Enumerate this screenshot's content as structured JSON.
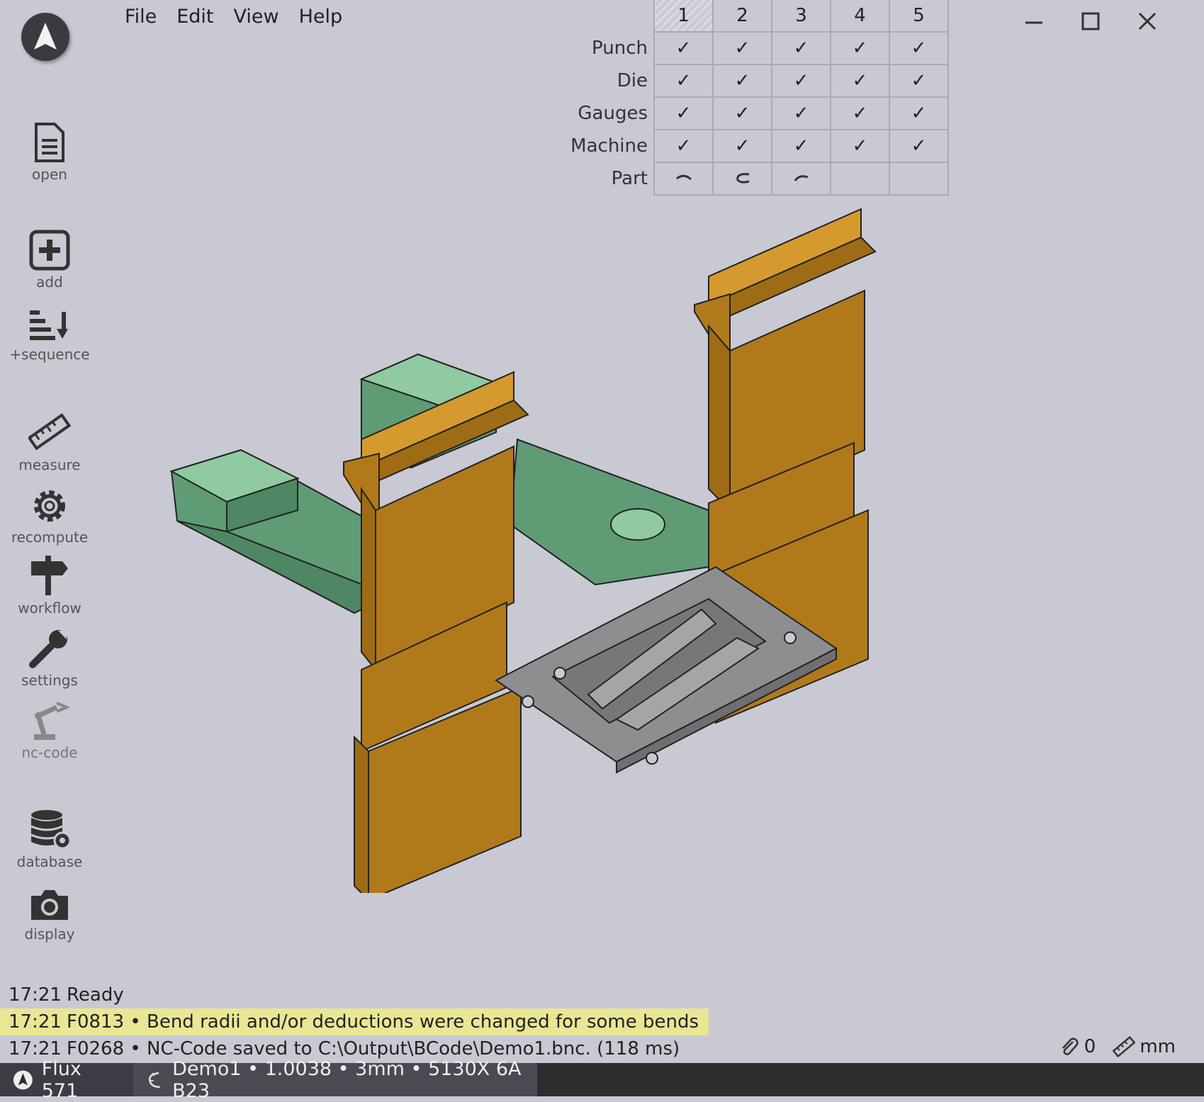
{
  "menu": {
    "items": [
      "File",
      "Edit",
      "View",
      "Help"
    ]
  },
  "sidebar": {
    "open": "open",
    "add": "add",
    "sequence": "+sequence",
    "measure": "measure",
    "recompute": "recompute",
    "workflow": "workflow",
    "settings": "settings",
    "nc_code": "nc-code",
    "database": "database",
    "display": "display"
  },
  "grid": {
    "columns": [
      "1",
      "2",
      "3",
      "4",
      "5"
    ],
    "active_column": "1",
    "rows": [
      {
        "label": "Punch",
        "cells": [
          "✓",
          "✓",
          "✓",
          "✓",
          "✓"
        ]
      },
      {
        "label": "Die",
        "cells": [
          "✓",
          "✓",
          "✓",
          "✓",
          "✓"
        ]
      },
      {
        "label": "Gauges",
        "cells": [
          "✓",
          "✓",
          "✓",
          "✓",
          "✓"
        ]
      },
      {
        "label": "Machine",
        "cells": [
          "✓",
          "✓",
          "✓",
          "✓",
          "✓"
        ]
      },
      {
        "label": "Part",
        "cells": [
          "part-icon",
          "part-icon",
          "part-icon",
          "",
          ""
        ]
      }
    ]
  },
  "log": [
    {
      "time": "17:21",
      "text": "Ready",
      "level": "info"
    },
    {
      "time": "17:21",
      "text": "F0813 • Bend radii and/or deductions were changed for some bends",
      "level": "warning"
    },
    {
      "time": "17:21",
      "text": "F0268 • NC-Code saved to C:\\Output\\BCode\\Demo1.bnc. (118 ms)",
      "level": "info"
    }
  ],
  "status": {
    "attachments": "0",
    "units": "mm"
  },
  "taskbar": {
    "app": "Flux 571",
    "job": "Demo1 • 1.0038 • 3mm • 5130X 6A B23"
  },
  "colors": {
    "background": "#c8c9d3",
    "tool_orange": "#b07a1a",
    "gauge_green": "#5a9a72",
    "part_gray": "#8e8e90",
    "warning": "#e9e694"
  }
}
